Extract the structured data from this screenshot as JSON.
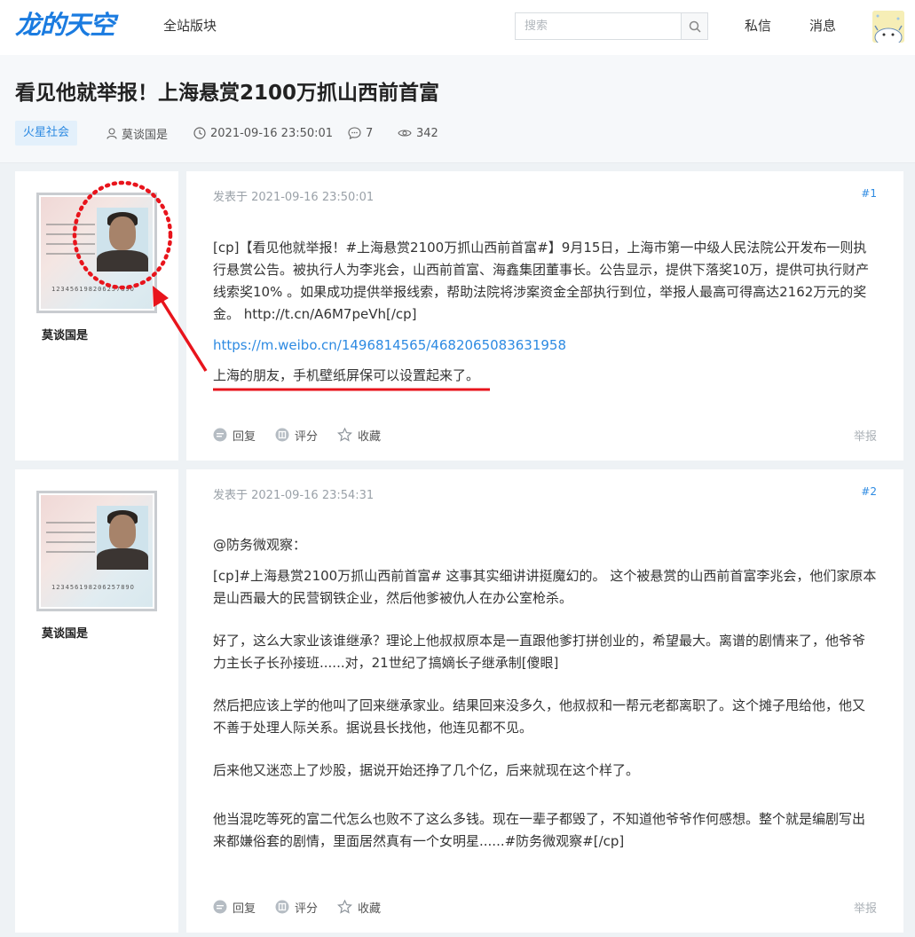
{
  "nav": {
    "logo": "龙的天空",
    "all_boards": "全站版块",
    "search_placeholder": "搜索",
    "private_msg": "私信",
    "messages": "消息"
  },
  "thread": {
    "title": "看见他就举报！上海悬赏2100万抓山西前首富",
    "board": "火星社会",
    "author": "莫谈国是",
    "datetime": "2021-09-16 23:50:01",
    "comments": "7",
    "views": "342"
  },
  "posts": [
    {
      "author": "莫谈国是",
      "time": "发表于 2021-09-16 23:50:01",
      "floor": "#1",
      "id_number": "12345619820625789O",
      "paragraphs": [
        "[cp]【看见他就举报！#上海悬赏2100万抓山西前首富#】9月15日，上海市第一中级人民法院公开发布一则执行悬赏公告。被执行人为李兆会，山西前首富、海鑫集团董事长。公告显示，提供下落奖10万，提供可执行财产线索奖10% 。如果成功提供举报线索，帮助法院将涉案资金全部执行到位，举报人最高可得高达2162万元的奖金。  http://t.cn/A6M7peVh[/cp]"
      ],
      "link": "https://m.weibo.cn/1496814565/4682065083631958",
      "highlight": "上海的朋友，手机壁纸屏保可以设置起来了。",
      "reply": "回复",
      "rate": "评分",
      "favorite": "收藏",
      "report": "举报"
    },
    {
      "author": "莫谈国是",
      "time": "发表于 2021-09-16 23:54:31",
      "floor": "#2",
      "id_number": "12345619820625789O",
      "paragraphs": [
        "@防务微观察：",
        "[cp]#上海悬赏2100万抓山西前首富# 这事其实细讲讲挺魔幻的。 这个被悬赏的山西前首富李兆会，他们家原本是山西最大的民营钢铁企业，然后他爹被仇人在办公室枪杀。",
        "好了，这么大家业该谁继承？理论上他叔叔原本是一直跟他爹打拼创业的，希望最大。离谱的剧情来了，他爷爷力主长子长孙接班......对，21世纪了搞嫡长子继承制[傻眼]",
        "然后把应该上学的他叫了回来继承家业。结果回来没多久，他叔叔和一帮元老都离职了。这个摊子甩给他，他又不善于处理人际关系。据说县长找他，他连见都不见。",
        "后来他又迷恋上了炒股，据说开始还挣了几个亿，后来就现在这个样了。",
        "他当混吃等死的富二代怎么也败不了这么多钱。现在一辈子都毁了，不知道他爷爷作何感想。整个就是编剧写出来都嫌俗套的剧情，里面居然真有一个女明星......#防务微观察#[/cp]"
      ],
      "reply": "回复",
      "rate": "评分",
      "favorite": "收藏",
      "report": "举报"
    }
  ],
  "colors": {
    "accent": "#2d8ae2",
    "annotation": "#e8141c"
  }
}
